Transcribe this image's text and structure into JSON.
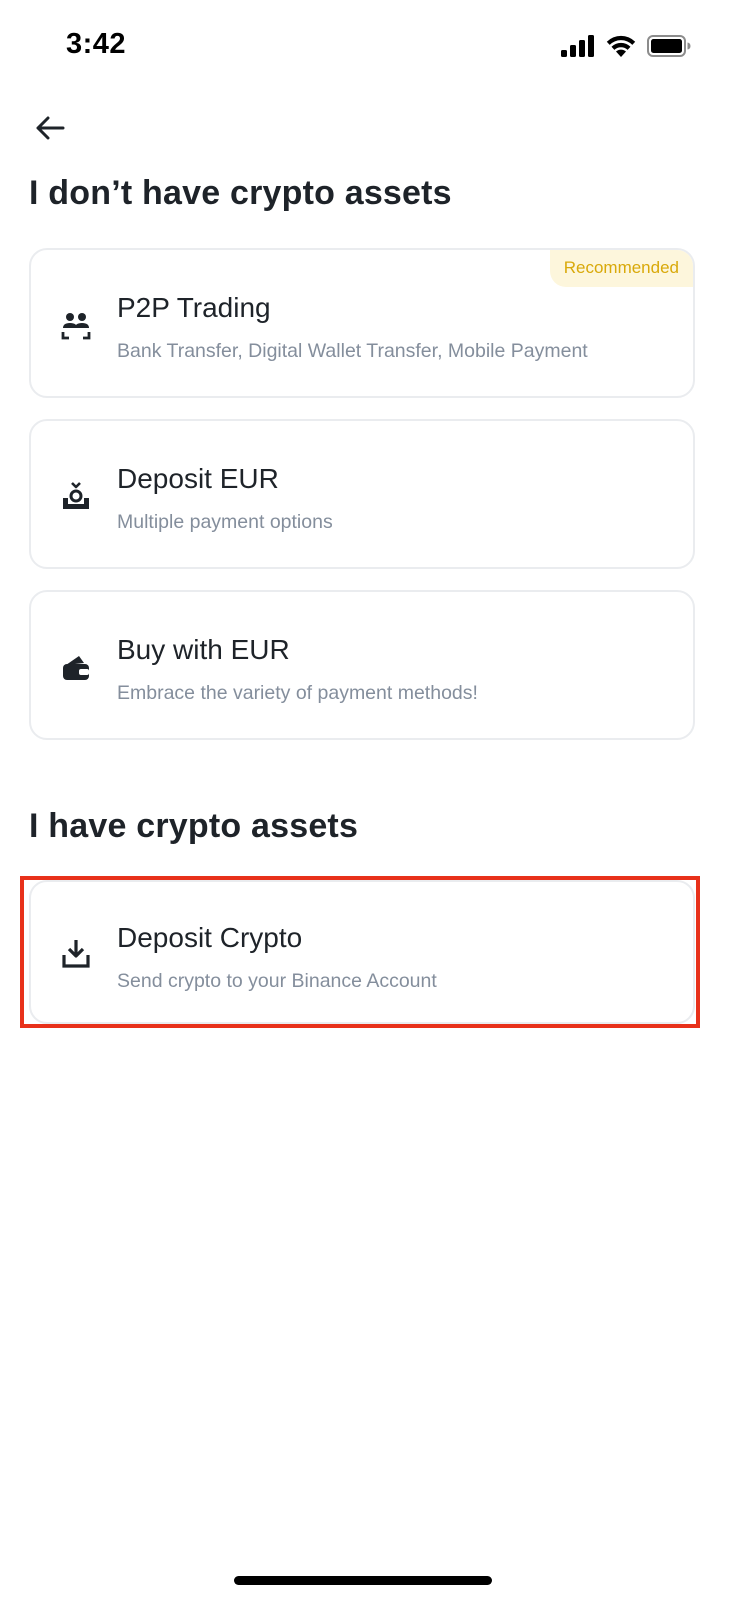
{
  "status_bar": {
    "time": "3:42",
    "icons": [
      "signal-icon",
      "wifi-icon",
      "battery-icon"
    ]
  },
  "nav": {
    "back_icon": "arrow-left-icon"
  },
  "sections": {
    "no_crypto_title": "I don’t have crypto assets",
    "have_crypto_title": "I have crypto assets"
  },
  "options": {
    "p2p": {
      "icon": "p2p-users-icon",
      "title": "P2P Trading",
      "subtitle": "Bank Transfer, Digital Wallet Transfer, Mobile Payment",
      "badge": "Recommended"
    },
    "deposit_eur": {
      "icon": "deposit-fiat-icon",
      "title": "Deposit EUR",
      "subtitle": "Multiple payment options"
    },
    "buy_eur": {
      "icon": "wallet-card-icon",
      "title": "Buy with EUR",
      "subtitle": "Embrace the variety of payment methods!"
    },
    "deposit_crypto": {
      "icon": "download-icon",
      "title": "Deposit Crypto",
      "subtitle": "Send crypto to your Binance Account"
    }
  },
  "colors": {
    "text_primary": "#1e2329",
    "text_secondary": "#848e9c",
    "badge_bg": "#fdf6dc",
    "badge_text": "#d9a90a",
    "card_border": "#eaecef",
    "highlight": "#e8311a"
  }
}
